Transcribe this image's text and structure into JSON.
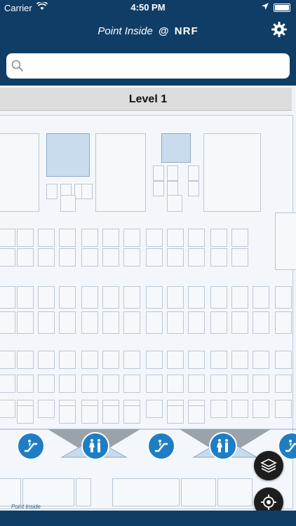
{
  "status": {
    "carrier": "Carrier",
    "time": "4:50 PM"
  },
  "header": {
    "brand_point": "Point",
    "brand_inside": "Inside",
    "brand_at": "@",
    "brand_event": "NRF",
    "settings_icon": "gear-icon"
  },
  "search": {
    "placeholder": "",
    "value": "",
    "icon": "search-icon"
  },
  "level": {
    "label": "Level 1"
  },
  "map_controls": {
    "layers_icon": "layers-icon",
    "locate_icon": "locate-icon"
  },
  "poi_icons": [
    "escalator-icon",
    "restroom-icon",
    "escalator-icon",
    "restroom-icon",
    "escalator-icon"
  ],
  "watermark": {
    "brand": "Point Inside"
  },
  "colors": {
    "nav": "#0f3d66",
    "poi": "#1f7ec3",
    "map_bg": "#eef4f9",
    "block_highlight": "#c9dcee",
    "level_bar": "#dcdcdc"
  }
}
